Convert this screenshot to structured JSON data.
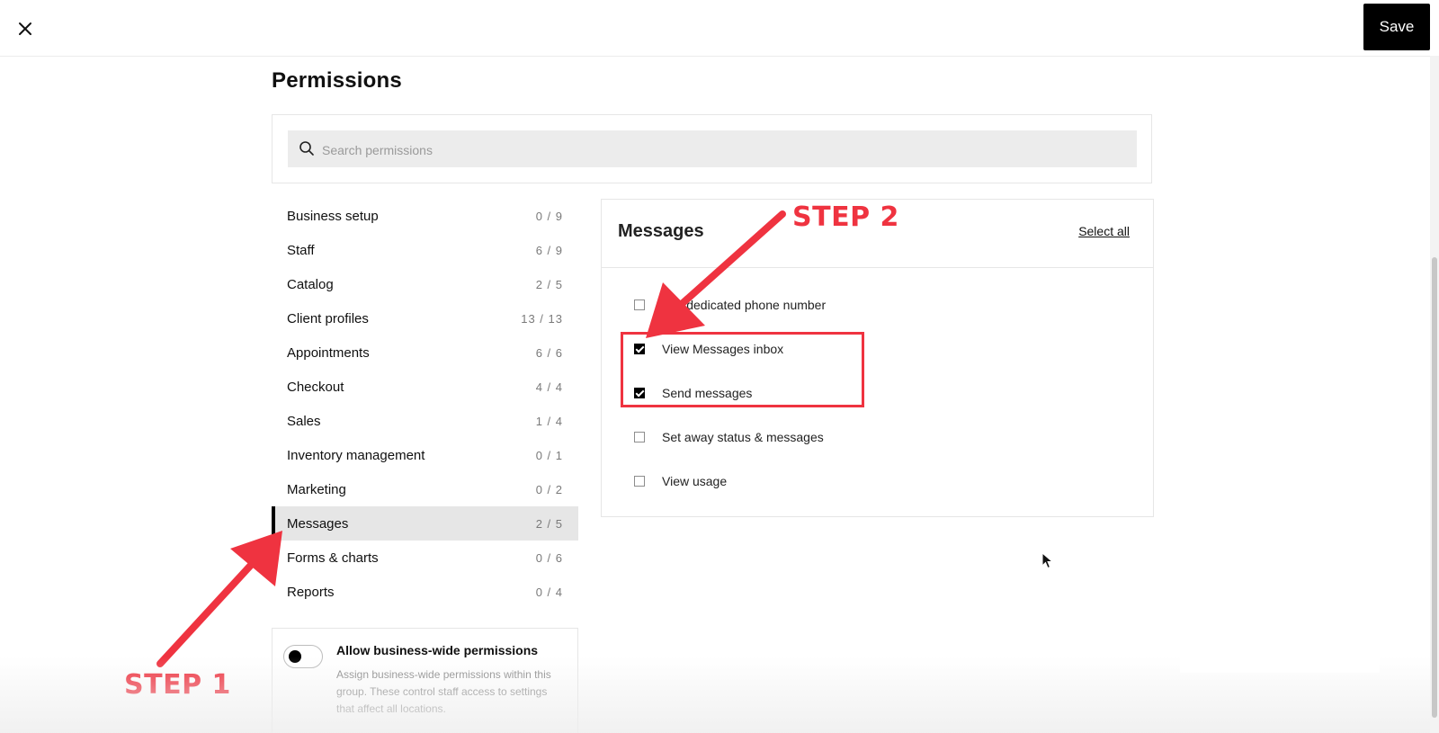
{
  "header": {
    "save_label": "Save"
  },
  "page": {
    "title": "Permissions"
  },
  "search": {
    "placeholder": "Search permissions"
  },
  "categories": [
    {
      "label": "Business setup",
      "count": "0 / 9"
    },
    {
      "label": "Staff",
      "count": "6 / 9"
    },
    {
      "label": "Catalog",
      "count": "2 / 5"
    },
    {
      "label": "Client profiles",
      "count": "13 / 13"
    },
    {
      "label": "Appointments",
      "count": "6 / 6"
    },
    {
      "label": "Checkout",
      "count": "4 / 4"
    },
    {
      "label": "Sales",
      "count": "1 / 4"
    },
    {
      "label": "Inventory management",
      "count": "0 / 1"
    },
    {
      "label": "Marketing",
      "count": "0 / 2"
    },
    {
      "label": "Messages",
      "count": "2 / 5",
      "active": true
    },
    {
      "label": "Forms & charts",
      "count": "0 / 6"
    },
    {
      "label": "Reports",
      "count": "0 / 4"
    }
  ],
  "business_wide": {
    "title": "Allow business-wide permissions",
    "description": "Assign business-wide permissions within this group. These control staff access to settings that affect all locations.",
    "enabled": false
  },
  "panel": {
    "title": "Messages",
    "select_all": "Select all",
    "permissions": [
      {
        "label": "ster dedicated phone number",
        "checked": false
      },
      {
        "label": "View Messages inbox",
        "checked": true
      },
      {
        "label": "Send messages",
        "checked": true
      },
      {
        "label": "Set away status & messages",
        "checked": false
      },
      {
        "label": "View usage",
        "checked": false
      }
    ]
  },
  "annotations": {
    "step1": "STEP 1",
    "step2": "STEP 2",
    "color": "#ef3340"
  },
  "icons": {
    "close": "close-icon",
    "search": "search-icon",
    "cursor": "mouse-cursor-icon"
  }
}
